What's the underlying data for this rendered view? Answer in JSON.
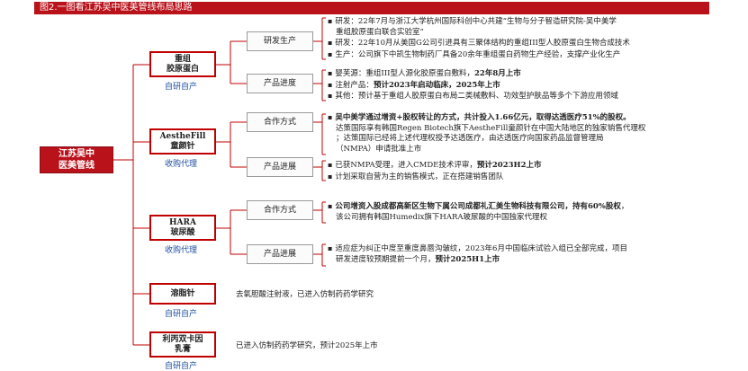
{
  "title": "图2.一图看江苏吴中医美管线布局思路",
  "root": {
    "line1": "江苏吴中",
    "line2": "医美管线"
  },
  "products": {
    "p1": {
      "name1": "重组",
      "name2": "胶原蛋白",
      "tag": "自研自产",
      "branches": {
        "rd": {
          "label": "研发生产",
          "lines": [
            "研发：22年7月与浙江大学杭州国际科创中心共建“生物与分子智造研究院-吴中美学",
            "重组胶原蛋白联合实验室”",
            "研发：22年10月从美国G公司引进具有三聚体结构的重组III型人胶原蛋白生物合成技术",
            "生产：公司旗下中凯生物制药厂具备20余年重组蛋白药物生产经验，支撑产业化生产"
          ]
        },
        "prog": {
          "label": "产品进度",
          "l1a": "婴芙源：重组III型人源化胶原蛋白敷料，",
          "l1b": "22年8月上市",
          "l2a": "注射产品：",
          "l2b": "预计2023年启动临床，2025年上市",
          "l3": "其他：预计基于重组人胶原蛋白布局二类械敷料、功效型护肤品等多个下游应用领域"
        }
      }
    },
    "p2": {
      "name1": "AestheFill",
      "name2": "童颜针",
      "tag": "收购代理",
      "branches": {
        "coop": {
          "label": "合作方式",
          "l1a": "吴中美学通过增资+股权转让的方式，共计投入1.66亿元，取得达透医疗51%的股权。",
          "l2": "达策国际享有韩国Regen Biotech旗下AestheFill童颜针在中国大陆地区的独家销售代理权",
          "l3": "；达策国际已经将上述代理权授予达透医疗，由达透医疗向国家药品监督管理局",
          "l4": "（NMPA）申请批准上市"
        },
        "prog": {
          "label": "产品进展",
          "l1a": "已获NMPA受理，进入CMDE技术评审，",
          "l1b": "预计2023H2上市",
          "l2": "计划采取自营为主的销售模式，正在搭建销售团队"
        }
      }
    },
    "p3": {
      "name1": "HARA",
      "name2": "玻尿酸",
      "tag": "收购代理",
      "branches": {
        "coop": {
          "label": "合作方式",
          "l1a": "公司增资入股成都高新区生物下属公司成都礼汇美生物科技有限公司，",
          "l1b": "持有60%股权",
          "l1c": "，",
          "l2": "该公司拥有韩国Humedix旗下HARA玻尿酸的中国独家代理权"
        },
        "prog": {
          "label": "产品进展",
          "l1": "适应症为纠正中度至重度鼻唇沟皱纹，2023年6月中国临床试验入组已全部完成，项目",
          "l2a": "研发进度较预期提前一个月，",
          "l2b": "预计2025H1上市"
        }
      }
    },
    "p4": {
      "name1": "溶脂针",
      "tag": "自研自产",
      "desc": "去氧胆酸注射液，已进入仿制药药学研究"
    },
    "p5": {
      "name1": "利丙双卡因",
      "name2": "乳膏",
      "tag": "自研自产",
      "desc": "已进入仿制药药学研究，预计2025年上市"
    }
  },
  "colors": {
    "accent_red": "#b9121b",
    "box_red": "#c00000",
    "tag_blue": "#1f4e9e",
    "line_red": "#c00000"
  }
}
